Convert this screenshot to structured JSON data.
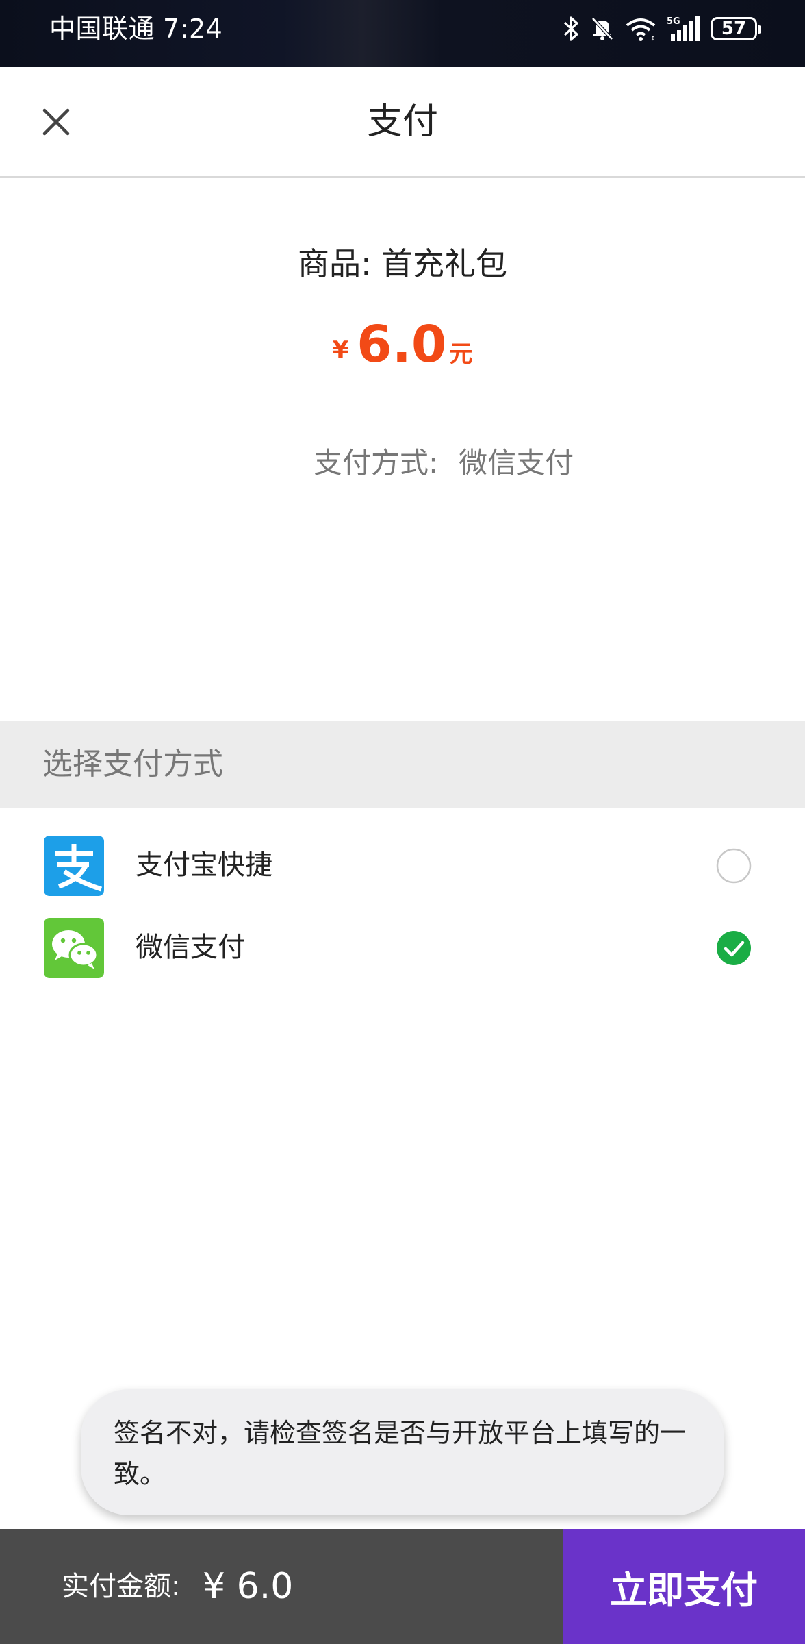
{
  "status_bar": {
    "carrier": "中国联通",
    "time": "7:24",
    "network": "5G",
    "battery": "57",
    "icons": [
      "bluetooth-icon",
      "mute-bell-icon",
      "wifi-icon",
      "signal-icon",
      "battery-icon"
    ]
  },
  "nav": {
    "title": "支付",
    "close_icon": "close-icon"
  },
  "order": {
    "product": "商品: 首充礼包",
    "currency_symbol": "¥",
    "amount": "6.0",
    "unit": "元",
    "method_label": "支付方式:",
    "method_value": "微信支付"
  },
  "payment_section": {
    "header": "选择支付方式",
    "options": [
      {
        "label": "支付宝快捷",
        "icon": "alipay-icon",
        "selected": false
      },
      {
        "label": "微信支付",
        "icon": "wechat-pay-icon",
        "selected": true
      }
    ]
  },
  "toast": {
    "message": "签名不对，请检查签名是否与开放平台上填写的一致。"
  },
  "bottom": {
    "amount_label": "实付金额:",
    "amount_value": "¥ 6.0",
    "pay_button": "立即支付"
  },
  "colors": {
    "price": "#f24a16",
    "pay_button": "#6a33c9",
    "bottom_bar": "#4b4b4b",
    "alipay": "#1d9fe8",
    "wechat": "#62c739",
    "check": "#1aad45"
  }
}
